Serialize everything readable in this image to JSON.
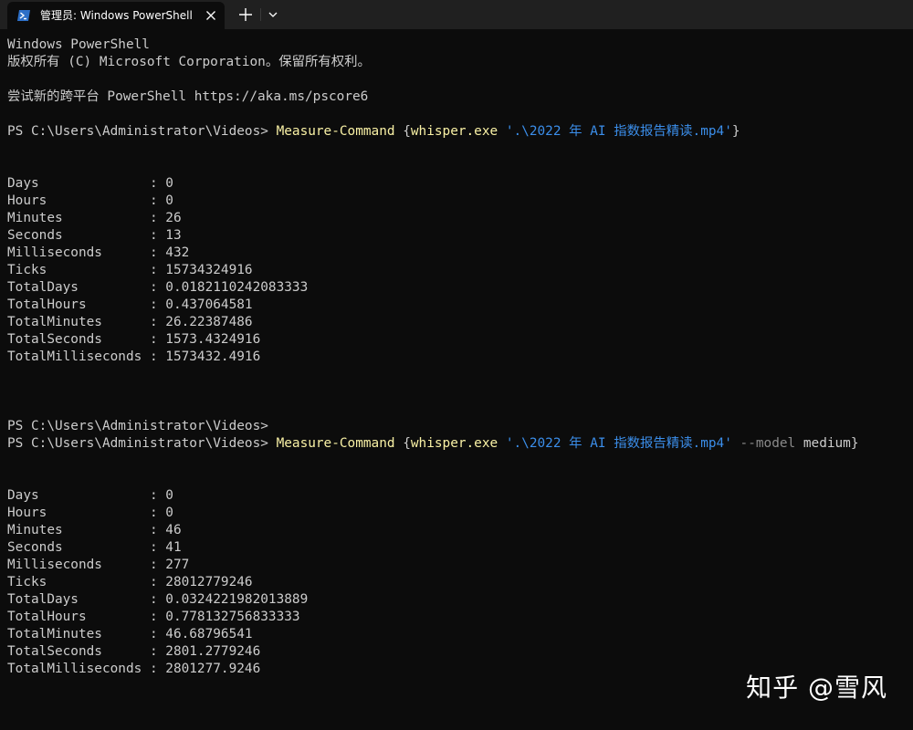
{
  "tab": {
    "title": "管理员: Windows PowerShell",
    "icon": "powershell-icon"
  },
  "banner": {
    "line1": "Windows PowerShell",
    "line2": "版权所有 (C) Microsoft Corporation。保留所有权利。",
    "line3": "尝试新的跨平台 PowerShell https://aka.ms/pscore6"
  },
  "prompt": "PS C:\\Users\\Administrator\\Videos> ",
  "run1": {
    "command": {
      "cmdlet": "Measure-Command",
      "open": " {",
      "exe": "whisper.exe",
      "sp": " ",
      "path": "'.\\2022 年 AI 指数报告精读.mp4'",
      "close": "}"
    },
    "results": [
      {
        "label": "Days              ",
        "sep": ": ",
        "value": "0"
      },
      {
        "label": "Hours             ",
        "sep": ": ",
        "value": "0"
      },
      {
        "label": "Minutes           ",
        "sep": ": ",
        "value": "26"
      },
      {
        "label": "Seconds           ",
        "sep": ": ",
        "value": "13"
      },
      {
        "label": "Milliseconds      ",
        "sep": ": ",
        "value": "432"
      },
      {
        "label": "Ticks             ",
        "sep": ": ",
        "value": "15734324916"
      },
      {
        "label": "TotalDays         ",
        "sep": ": ",
        "value": "0.0182110242083333"
      },
      {
        "label": "TotalHours        ",
        "sep": ": ",
        "value": "0.437064581"
      },
      {
        "label": "TotalMinutes      ",
        "sep": ": ",
        "value": "26.22387486"
      },
      {
        "label": "TotalSeconds      ",
        "sep": ": ",
        "value": "1573.4324916"
      },
      {
        "label": "TotalMilliseconds ",
        "sep": ": ",
        "value": "1573432.4916"
      }
    ]
  },
  "run2": {
    "command": {
      "cmdlet": "Measure-Command",
      "open": " {",
      "exe": "whisper.exe",
      "sp": " ",
      "path": "'.\\2022 年 AI 指数报告精读.mp4'",
      "param": " --model",
      "arg": " medium",
      "close": "}"
    },
    "results": [
      {
        "label": "Days              ",
        "sep": ": ",
        "value": "0"
      },
      {
        "label": "Hours             ",
        "sep": ": ",
        "value": "0"
      },
      {
        "label": "Minutes           ",
        "sep": ": ",
        "value": "46"
      },
      {
        "label": "Seconds           ",
        "sep": ": ",
        "value": "41"
      },
      {
        "label": "Milliseconds      ",
        "sep": ": ",
        "value": "277"
      },
      {
        "label": "Ticks             ",
        "sep": ": ",
        "value": "28012779246"
      },
      {
        "label": "TotalDays         ",
        "sep": ": ",
        "value": "0.0324221982013889"
      },
      {
        "label": "TotalHours        ",
        "sep": ": ",
        "value": "0.778132756833333"
      },
      {
        "label": "TotalMinutes      ",
        "sep": ": ",
        "value": "46.68796541"
      },
      {
        "label": "TotalSeconds      ",
        "sep": ": ",
        "value": "2801.2779246"
      },
      {
        "label": "TotalMilliseconds ",
        "sep": ": ",
        "value": "2801277.9246"
      }
    ]
  },
  "watermark": "知乎 @雪风",
  "colors": {
    "background": "#0c0c0c",
    "tabbar": "#202020",
    "text": "#cccccc",
    "cmdlet": "#f9f1a5",
    "string": "#3b8eea",
    "parameter": "#8a8a8a"
  }
}
